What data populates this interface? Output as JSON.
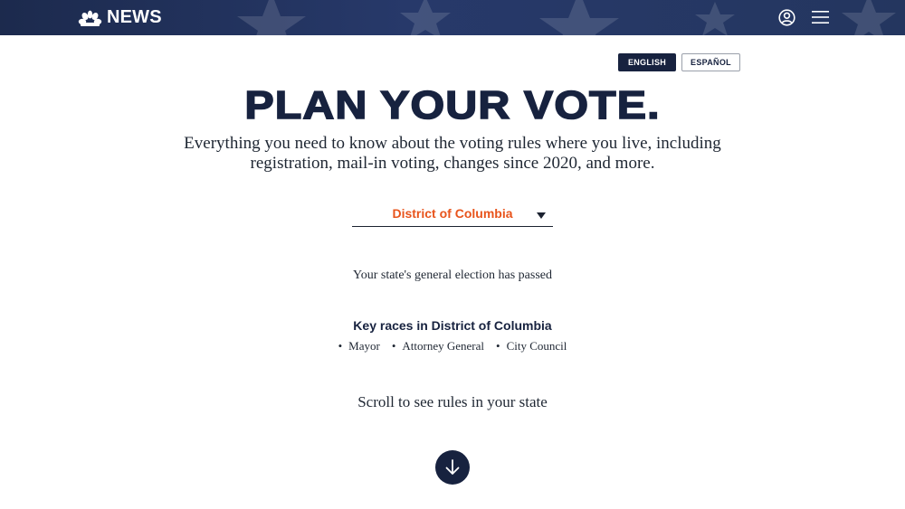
{
  "header": {
    "logo_text": "NEWS",
    "logo_icon": "peacock-icon",
    "account_icon": "user-circle-icon",
    "menu_icon": "hamburger-icon",
    "background_color": "#1c2a4d"
  },
  "language": {
    "english_label": "ENGLISH",
    "spanish_label": "ESPAÑOL",
    "selected": "ENGLISH"
  },
  "hero": {
    "headline": "PLAN YOUR VOTE",
    "subtitle": "Everything you need to know about the voting rules where you live, including registration, mail-in voting, changes since 2020, and more."
  },
  "state_select": {
    "selected": "District of Columbia",
    "accent_color": "#e8541c"
  },
  "election_status": "Your state's general election has passed",
  "key_races": {
    "title": "Key races in District of Columbia",
    "items": [
      "Mayor",
      "Attorney General",
      "City Council"
    ]
  },
  "scroll_prompt": "Scroll to see rules in your state",
  "scroll_icon": "arrow-down-icon"
}
